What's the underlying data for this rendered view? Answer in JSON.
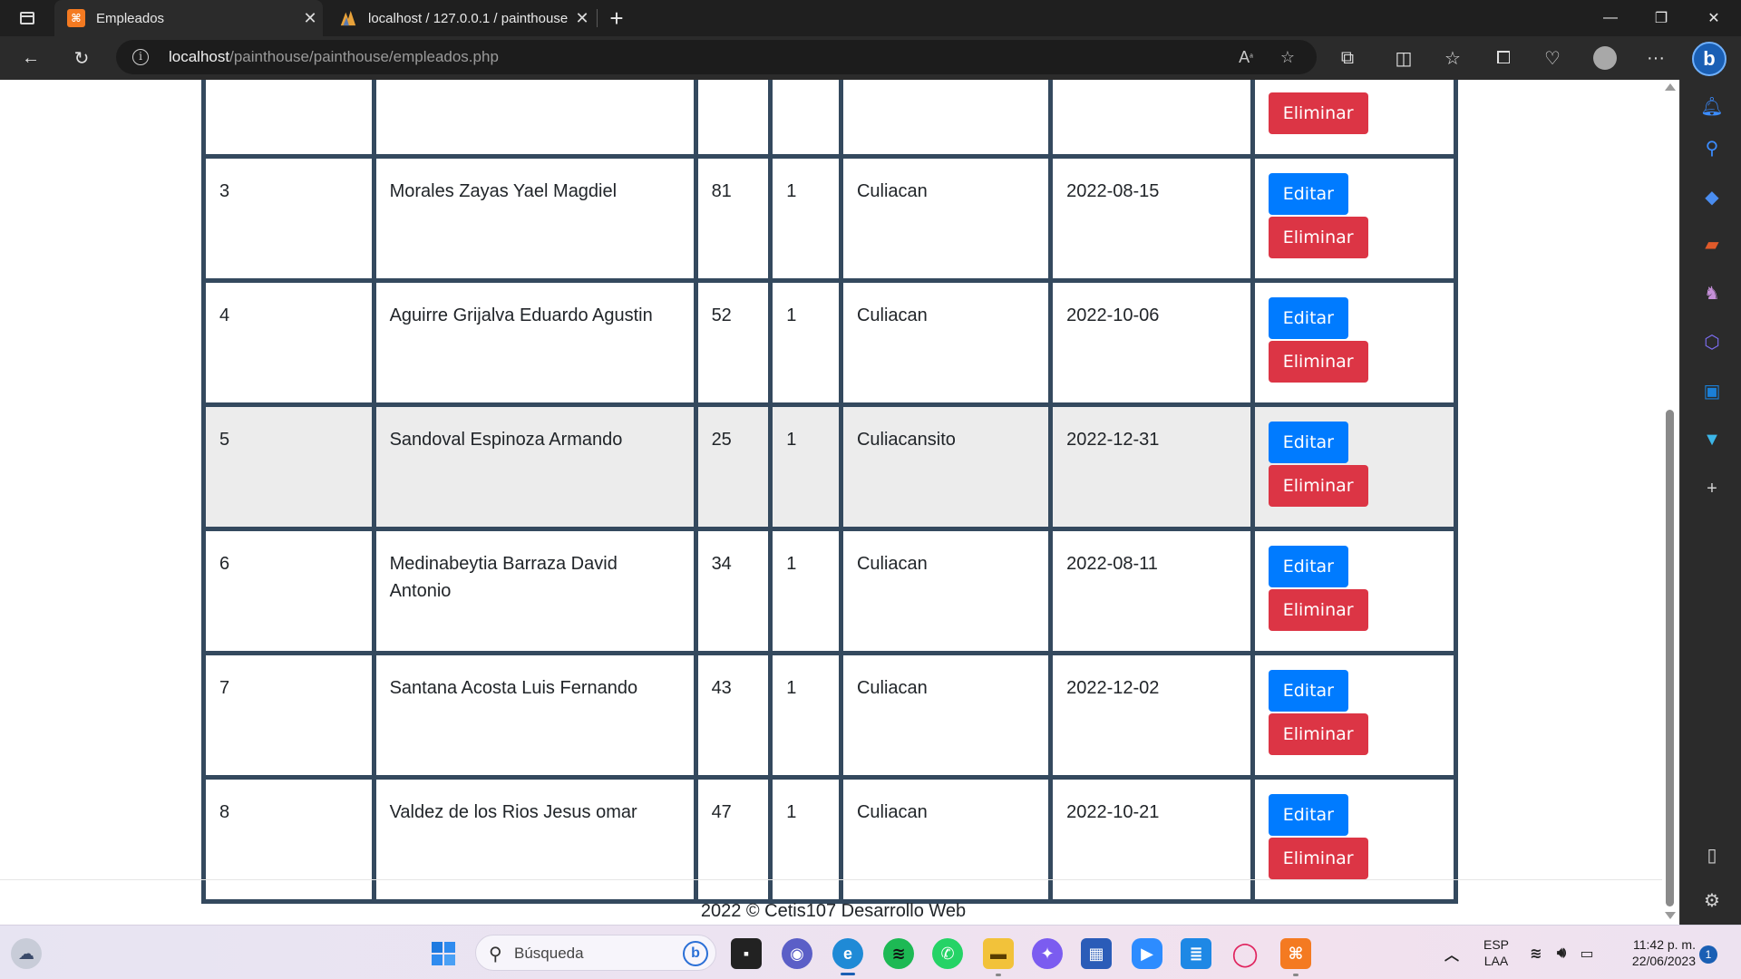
{
  "browser": {
    "tabs": [
      {
        "title": "Empleados",
        "favicon": "xampp-icon",
        "active": true
      },
      {
        "title": "localhost / 127.0.0.1 / painthouse",
        "favicon": "phpmyadmin-icon",
        "active": false
      }
    ],
    "url_host": "localhost",
    "url_path": "/painthouse/painthouse/empleados.php"
  },
  "table": {
    "partial_row_button": "Eliminar",
    "rows": [
      {
        "id": "3",
        "name": "Morales Zayas Yael Magdiel",
        "age": "81",
        "num": "1",
        "city": "Culiacan",
        "date": "2022-08-15",
        "edit": "Editar",
        "delete": "Eliminar",
        "highlight": false
      },
      {
        "id": "4",
        "name": "Aguirre Grijalva Eduardo Agustin",
        "age": "52",
        "num": "1",
        "city": "Culiacan",
        "date": "2022-10-06",
        "edit": "Editar",
        "delete": "Eliminar",
        "highlight": false
      },
      {
        "id": "5",
        "name": "Sandoval Espinoza Armando",
        "age": "25",
        "num": "1",
        "city": "Culiacansito",
        "date": "2022-12-31",
        "edit": "Editar",
        "delete": "Eliminar",
        "highlight": true
      },
      {
        "id": "6",
        "name": "Medinabeytia Barraza David Antonio",
        "age": "34",
        "num": "1",
        "city": "Culiacan",
        "date": "2022-08-11",
        "edit": "Editar",
        "delete": "Eliminar",
        "highlight": false
      },
      {
        "id": "7",
        "name": "Santana Acosta Luis Fernando",
        "age": "43",
        "num": "1",
        "city": "Culiacan",
        "date": "2022-12-02",
        "edit": "Editar",
        "delete": "Eliminar",
        "highlight": false
      },
      {
        "id": "8",
        "name": "Valdez de los Rios Jesus omar",
        "age": "47",
        "num": "1",
        "city": "Culiacan",
        "date": "2022-10-21",
        "edit": "Editar",
        "delete": "Eliminar",
        "highlight": false
      }
    ]
  },
  "footer": {
    "text": "2022 © Cetis107 Desarrollo Web"
  },
  "taskbar": {
    "search_placeholder": "Búsqueda",
    "lang_top": "ESP",
    "lang_bottom": "LAA",
    "time": "11:42 p. m.",
    "date": "22/06/2023",
    "notifications": "1"
  },
  "colors": {
    "table_border": "#34495e",
    "edit_button": "#007bff",
    "delete_button": "#dc3545",
    "highlight_row": "#ececec"
  }
}
